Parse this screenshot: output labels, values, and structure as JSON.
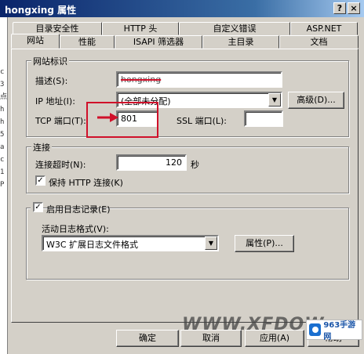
{
  "window": {
    "title": "hongxing 属性",
    "help_btn": "?",
    "close_btn": "×"
  },
  "background_window": {
    "fragments": [
      "c",
      "3",
      "点",
      "h",
      "h",
      "5",
      "a",
      "c",
      "1",
      "P"
    ]
  },
  "tabs": {
    "row1": [
      "目录安全性",
      "HTTP 头",
      "自定义错误",
      "ASP.NET"
    ],
    "row2": [
      "网站",
      "性能",
      "ISAPI 筛选器",
      "主目录",
      "文档"
    ],
    "selected": "网站"
  },
  "site_id": {
    "group_label": "网站标识",
    "description_label": "描述(S):",
    "description_value": "hongxing",
    "ip_label": "IP 地址(I):",
    "ip_value": "(全部未分配)",
    "advanced_button": "高级(D)...",
    "tcp_label": "TCP 端口(T):",
    "tcp_value": "801",
    "ssl_label": "SSL 端口(L):",
    "ssl_value": ""
  },
  "connection": {
    "group_label": "连接",
    "timeout_label": "连接超时(N):",
    "timeout_value": "120",
    "timeout_unit": "秒",
    "keepalive_label": "保持 HTTP 连接(K)",
    "keepalive_checked": true
  },
  "logging": {
    "enable_label": "启用日志记录(E)",
    "enable_checked": true,
    "format_label": "活动日志格式(V):",
    "format_value": "W3C 扩展日志文件格式",
    "properties_button": "属性(P)..."
  },
  "footer": {
    "ok": "确定",
    "cancel": "取消",
    "apply": "应用(A)",
    "help": "帮助"
  },
  "overlay": {
    "watermark": "WWW.XFDOW",
    "logo_text": "963手游网"
  },
  "colors": {
    "title_bar": "#0a246a",
    "annotation": "#d0102a",
    "dialog_face": "#d4d0c8"
  }
}
